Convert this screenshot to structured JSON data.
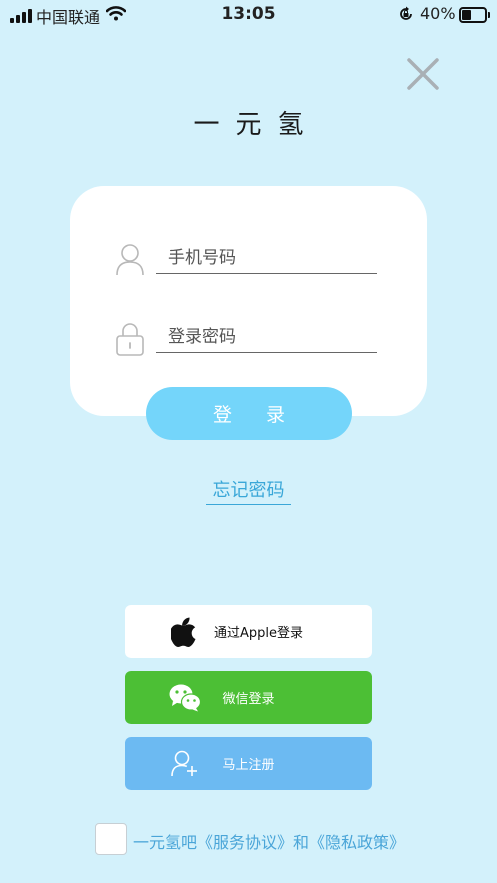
{
  "status_bar": {
    "carrier": "中国联通",
    "time": "13:05",
    "battery": "40%",
    "battery_level": 0.4,
    "icons": [
      "signal-icon",
      "wifi-icon",
      "orientation-lock-icon",
      "battery-icon"
    ]
  },
  "header": {
    "title": "一元氢",
    "close_icon": "close-icon"
  },
  "login_form": {
    "phone_placeholder": "手机号码",
    "password_placeholder": "登录密码",
    "phone_icon": "user-icon",
    "password_icon": "lock-icon",
    "login_label": "登 录",
    "forgot_label": "忘记密码"
  },
  "alt_login": {
    "apple_label": "通过Apple登录",
    "wechat_label": "微信登录",
    "register_label": "马上注册"
  },
  "agreement": {
    "prefix": "一元氢吧",
    "terms": "《服务协议》",
    "conj": "和",
    "privacy": "《隐私政策》"
  },
  "colors": {
    "background": "#d3f1fb",
    "accent": "#74d5fa",
    "link": "#3aa7d8",
    "wechat": "#4cbf35",
    "register": "#6cbaf2"
  }
}
